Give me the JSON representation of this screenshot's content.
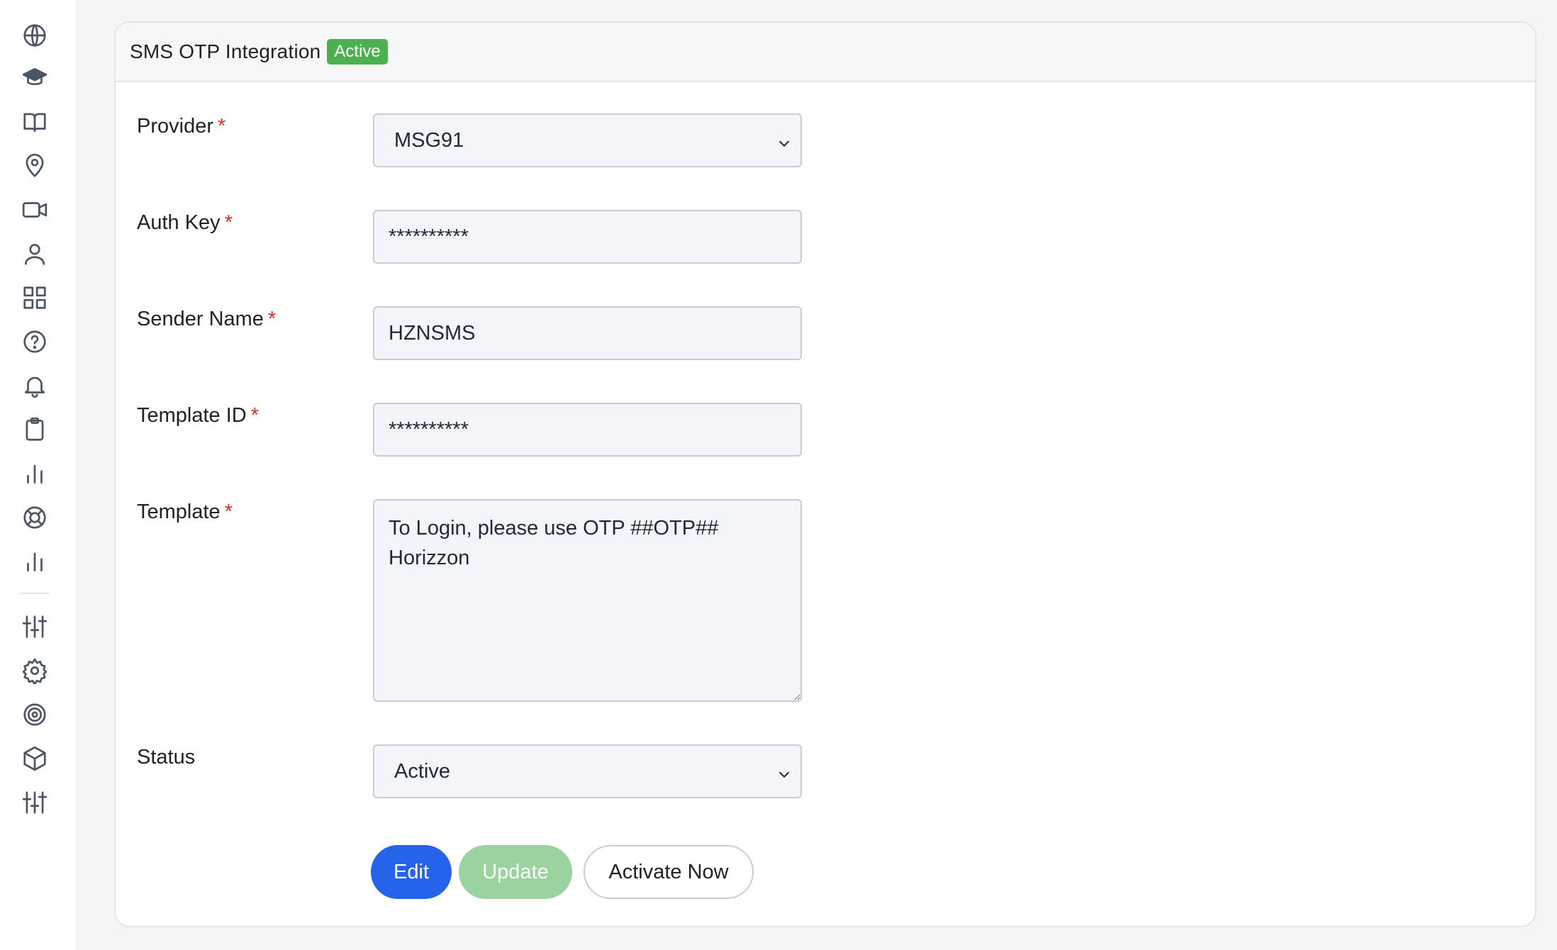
{
  "sidebar": {
    "icons": [
      "globe-icon",
      "graduation-cap-icon",
      "book-open-icon",
      "map-pin-icon",
      "video-icon",
      "user-icon",
      "grid-icon",
      "help-circle-icon",
      "bell-icon",
      "clipboard-icon",
      "bar-chart-icon",
      "life-buoy-icon",
      "bar-chart-icon",
      "sliders-icon",
      "gear-icon",
      "target-icon",
      "package-icon",
      "sliders-icon"
    ]
  },
  "card": {
    "title": "SMS OTP Integration",
    "badge": "Active",
    "badge_color": "#4caf50"
  },
  "form": {
    "provider": {
      "label": "Provider",
      "required": "*",
      "value": "MSG91"
    },
    "auth_key": {
      "label": "Auth Key",
      "required": "*",
      "value": "**********"
    },
    "sender_name": {
      "label": "Sender Name",
      "required": "*",
      "value": "HZNSMS"
    },
    "template_id": {
      "label": "Template ID",
      "required": "*",
      "value": "**********"
    },
    "template": {
      "label": "Template",
      "required": "*",
      "value": "To Login, please use OTP ##OTP## Horizzon"
    },
    "status": {
      "label": "Status",
      "value": "Active"
    }
  },
  "buttons": {
    "edit": "Edit",
    "update": "Update",
    "activate": "Activate Now"
  },
  "colors": {
    "primary": "#2563eb",
    "success_light": "#9ad3a0",
    "required": "#d93025"
  }
}
